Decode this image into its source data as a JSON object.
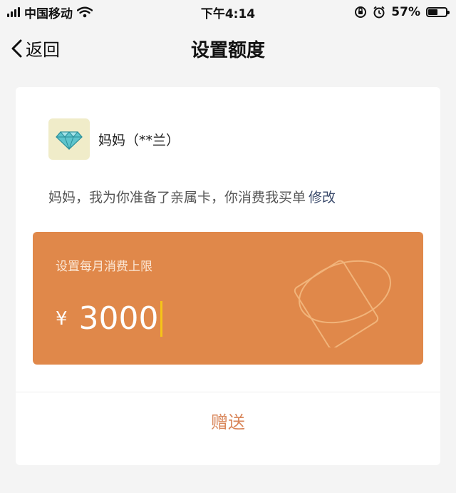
{
  "status_bar": {
    "carrier": "中国移动",
    "time": "下午4:14",
    "battery": "57%",
    "battery_level": 0.57
  },
  "nav": {
    "back_label": "返回",
    "title": "设置额度"
  },
  "recipient": {
    "name": "妈妈（**兰）"
  },
  "message": {
    "text": "妈妈，我为你准备了亲属卡，你消费我买单",
    "edit_label": "修改"
  },
  "amount_card": {
    "label": "设置每月消费上限",
    "currency": "¥",
    "amount": "3000",
    "background": "#e0884a",
    "cursor_color": "#f5c518"
  },
  "send_button": {
    "label": "赠送",
    "color": "#d9865a"
  }
}
